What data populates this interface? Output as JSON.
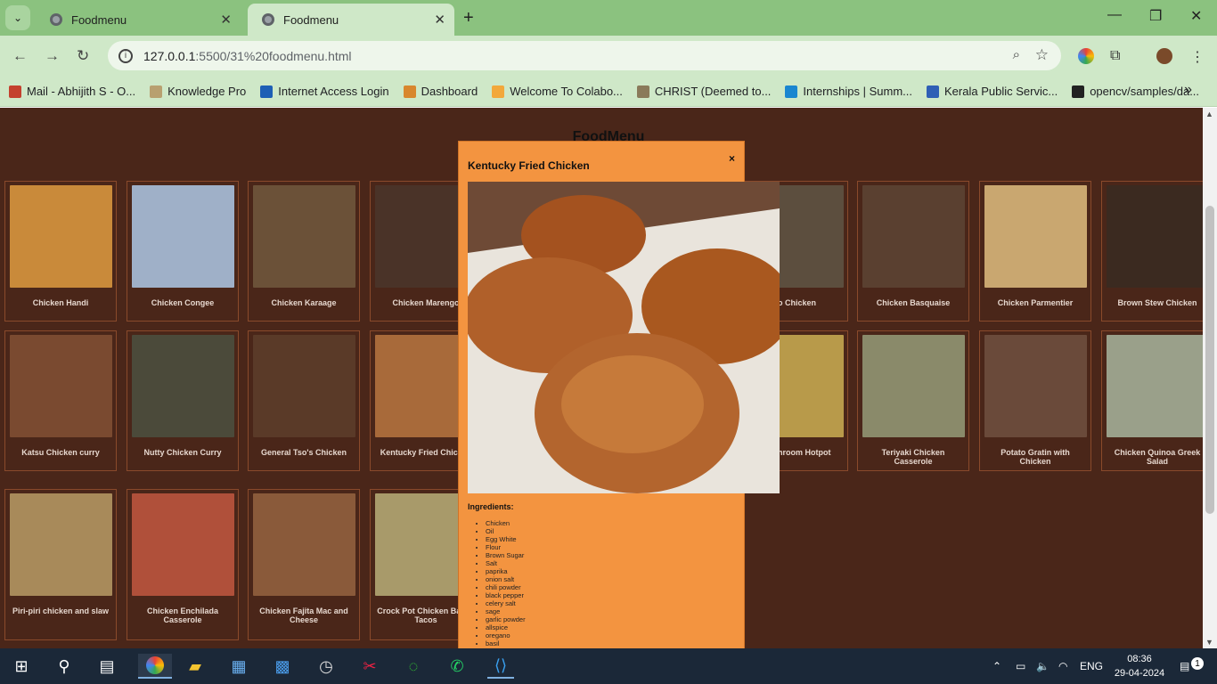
{
  "browser": {
    "tabs": [
      {
        "title": "Foodmenu",
        "active": false
      },
      {
        "title": "Foodmenu",
        "active": true
      }
    ],
    "url_host": "127.0.0.1",
    "url_path": ":5500/31%20foodmenu.html",
    "bookmarks": [
      {
        "label": "Mail - Abhijith S - O...",
        "color": "#c4412e"
      },
      {
        "label": "Knowledge Pro",
        "color": "#b8a070"
      },
      {
        "label": "Internet Access Login",
        "color": "#1e5fb5"
      },
      {
        "label": "Dashboard",
        "color": "#d8872e"
      },
      {
        "label": "Welcome To Colabo...",
        "color": "#f2a83b"
      },
      {
        "label": "CHRIST (Deemed to...",
        "color": "#8a7a5a"
      },
      {
        "label": "Internships | Summ...",
        "color": "#1a86d0"
      },
      {
        "label": "Kerala Public Servic...",
        "color": "#2f5fb5"
      },
      {
        "label": "opencv/samples/da...",
        "color": "#222222"
      }
    ]
  },
  "page": {
    "heading": "FoodMenu",
    "cards": [
      {
        "name": "Chicken Handi",
        "color": "#c98a3a"
      },
      {
        "name": "Chicken Congee",
        "color": "#9fb0c8"
      },
      {
        "name": "Chicken Karaage",
        "color": "#6b5138"
      },
      {
        "name": "Chicken Marengo",
        "color": "#4a3328"
      },
      {
        "name": "Pao Chicken",
        "color": "#5c4e3e"
      },
      {
        "name": "Chicken Basquaise",
        "color": "#5a4030"
      },
      {
        "name": "Chicken Parmentier",
        "color": "#c9a770"
      },
      {
        "name": "Brown Stew Chicken",
        "color": "#3b2a20"
      },
      {
        "name": "Katsu Chicken curry",
        "color": "#7a4a30"
      },
      {
        "name": "Nutty Chicken Curry",
        "color": "#4b4a3a"
      },
      {
        "name": "General Tso's Chicken",
        "color": "#5a3a28"
      },
      {
        "name": "Kentucky Fried Chicken",
        "color": "#a86a3a"
      },
      {
        "name": "& mushroom Hotpot",
        "color": "#b89a4a"
      },
      {
        "name": "Teriyaki Chicken Casserole",
        "color": "#8a8a6a"
      },
      {
        "name": "Potato Gratin with Chicken",
        "color": "#6a4a3a"
      },
      {
        "name": "Chicken Quinoa Greek Salad",
        "color": "#9aa08a"
      },
      {
        "name": "Piri-piri chicken and slaw",
        "color": "#a88a5a"
      },
      {
        "name": "Chicken Enchilada Casserole",
        "color": "#b0503a"
      },
      {
        "name": "Chicken Fajita Mac and Cheese",
        "color": "#8a5a3a"
      },
      {
        "name": "Crock Pot Chicken Baked Tacos",
        "color": "#a89a6a"
      }
    ]
  },
  "modal": {
    "title": "Kentucky Fried Chicken",
    "close_label": "×",
    "ingredients_label": "Ingredients:",
    "ingredients": [
      "Chicken",
      "Oil",
      "Egg White",
      "Flour",
      "Brown Sugar",
      "Salt",
      "paprika",
      "onion salt",
      "chili powder",
      "black pepper",
      "celery salt",
      "sage",
      "garlic powder",
      "allspice",
      "oregano",
      "basil"
    ]
  },
  "taskbar": {
    "lang": "ENG",
    "time": "08:36",
    "date": "29-04-2024",
    "notifications": "1"
  }
}
